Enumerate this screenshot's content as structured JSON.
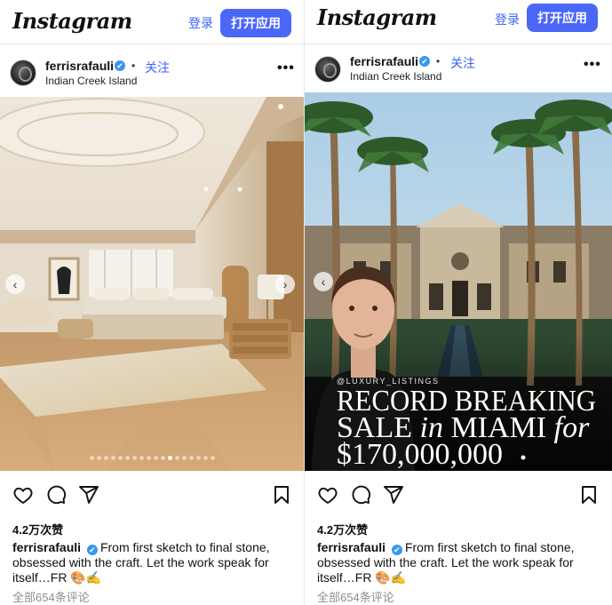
{
  "header": {
    "logo": "Instagram",
    "login": "登录",
    "open_app": "打开应用"
  },
  "colors": {
    "accent": "#4b67f7",
    "link": "#3b62f5",
    "verified": "#3897f0"
  },
  "posts": [
    {
      "username": "ferrisrafauli",
      "verified_icon": "✔",
      "dot": "•",
      "follow": "关注",
      "location": "Indian Creek Island",
      "more": "•••",
      "media": {
        "kind": "bedroom-photo",
        "carousel_total": 18,
        "carousel_active": 11
      },
      "likes": "4.2万次赞",
      "caption_user": "ferrisrafauli",
      "caption_text": "From first sketch to final stone, obsessed with the craft. Let the work speak for itself…FR 🎨✍️",
      "comments": "全部654条评论",
      "icons": [
        "heart-icon",
        "comment-icon",
        "share-icon",
        "bookmark-icon"
      ]
    },
    {
      "username": "ferrisrafauli",
      "verified_icon": "✔",
      "dot": "•",
      "follow": "关注",
      "location": "Indian Creek Island",
      "more": "•••",
      "media": {
        "kind": "mansion-photo",
        "handle_tag": "@LUXURY_LISTINGS",
        "headline_1": "RECORD BREAKING",
        "headline_2a": "SALE ",
        "headline_2b": "in",
        "headline_2c": " MIAMI ",
        "headline_2d": "for",
        "headline_3": "$170,000,000"
      },
      "likes": "4.2万次赞",
      "caption_user": "ferrisrafauli",
      "caption_text": "From first sketch to final stone, obsessed with the craft. Let the work speak for itself…FR 🎨✍️",
      "comments": "全部654条评论",
      "icons": [
        "heart-icon",
        "comment-icon",
        "share-icon",
        "bookmark-icon"
      ]
    }
  ]
}
